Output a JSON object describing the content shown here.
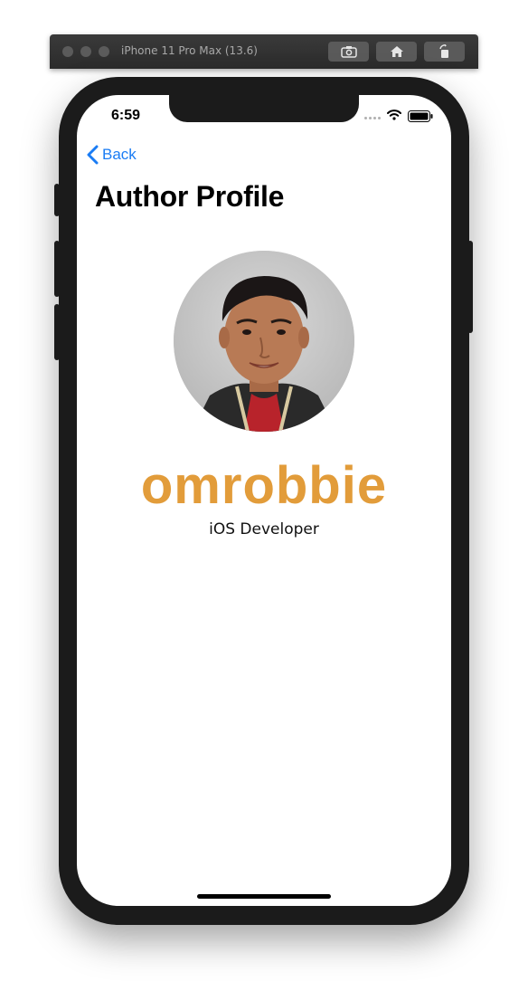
{
  "simulator": {
    "title": "iPhone 11 Pro Max (13.6)",
    "buttons": [
      "screenshot-icon",
      "home-icon",
      "rotate-icon"
    ]
  },
  "status_bar": {
    "time": "6:59",
    "icons": [
      "signal-icon",
      "wifi-icon",
      "battery-icon"
    ]
  },
  "nav": {
    "back_label": "Back",
    "title": "Author Profile"
  },
  "profile": {
    "name": "omrobbie",
    "role": "iOS Developer",
    "name_color": "#e29c3a"
  },
  "colors": {
    "accent": "#1a7cf4"
  }
}
